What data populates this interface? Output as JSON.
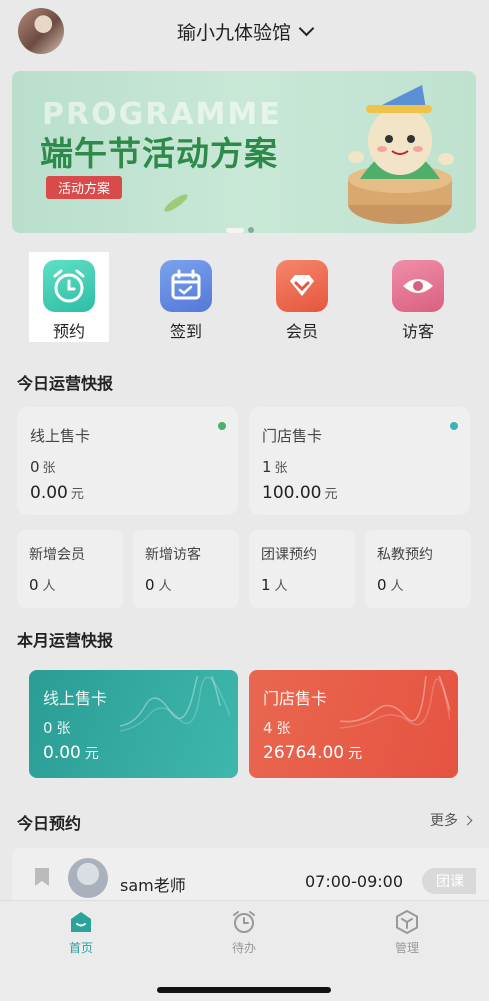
{
  "header": {
    "store_name": "瑜小九体验馆"
  },
  "banner": {
    "watermark": "PROGRAMME",
    "headline": "端午节活动方案",
    "tag": "活动方案",
    "page_count": 2,
    "active_page": 1
  },
  "quick_actions": [
    {
      "label": "预约",
      "icon": "alarm-clock-icon",
      "color": "#3fcdb3",
      "active": true
    },
    {
      "label": "签到",
      "icon": "calendar-check-icon",
      "color": "#6a8ce6"
    },
    {
      "label": "会员",
      "icon": "vip-diamond-icon",
      "color": "#ee6f55"
    },
    {
      "label": "访客",
      "icon": "eye-icon",
      "color": "#e07595"
    }
  ],
  "today": {
    "title": "今日运营快报",
    "online": {
      "label": "线上售卡",
      "count": "0",
      "count_unit": "张",
      "amount": "0.00",
      "amount_unit": "元",
      "dot_color": "#4caf6e"
    },
    "store": {
      "label": "门店售卡",
      "count": "1",
      "count_unit": "张",
      "amount": "100.00",
      "amount_unit": "元",
      "dot_color": "#3fb3b3"
    },
    "stats": [
      {
        "label": "新增会员",
        "value": "0",
        "unit": "人"
      },
      {
        "label": "新增访客",
        "value": "0",
        "unit": "人"
      },
      {
        "label": "团课预约",
        "value": "1",
        "unit": "人"
      },
      {
        "label": "私教预约",
        "value": "0",
        "unit": "人"
      }
    ]
  },
  "month": {
    "title": "本月运营快报",
    "online": {
      "label": "线上售卡",
      "count": "0",
      "count_unit": "张",
      "amount": "0.00",
      "amount_unit": "元"
    },
    "store": {
      "label": "门店售卡",
      "count": "4",
      "count_unit": "张",
      "amount": "26764.00",
      "amount_unit": "元"
    }
  },
  "appointments": {
    "title": "今日预约",
    "more": "更多",
    "items": [
      {
        "coach": "sam老师",
        "time": "07:00-09:00",
        "type": "团课"
      }
    ]
  },
  "tabbar": [
    {
      "label": "首页",
      "icon": "home-icon",
      "active": true
    },
    {
      "label": "待办",
      "icon": "alarm-clock-icon"
    },
    {
      "label": "管理",
      "icon": "cube-icon"
    }
  ],
  "colors": {
    "accent": "#2aa39a",
    "teal_card": "#2aa39a",
    "red_card": "#e85c4a"
  }
}
